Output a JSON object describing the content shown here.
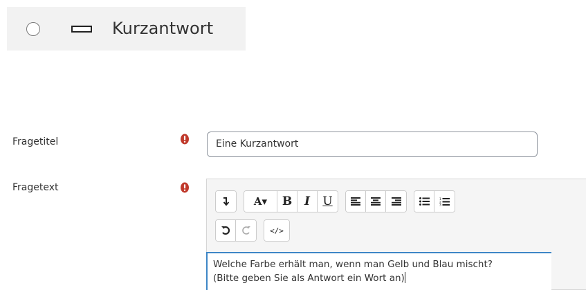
{
  "question_type": {
    "title": "Kurzantwort",
    "radio_icon": "radio-unchecked-icon",
    "type_icon": "short-answer-rect-icon"
  },
  "form": {
    "title_label": "Fragetitel",
    "title_value": "Eine Kurzantwort",
    "text_label": "Fragetext",
    "required_icon": "exclamation-circle-icon",
    "required_color": "#c0392b"
  },
  "editor": {
    "toolbar": {
      "row1": [
        {
          "name": "collapse-toolbar-button",
          "icon": "arrow-down-icon"
        },
        {
          "name": "font-style-button",
          "label": "A▾"
        },
        {
          "name": "bold-button",
          "label": "B"
        },
        {
          "name": "italic-button",
          "label": "I"
        },
        {
          "name": "underline-button",
          "label": "U"
        },
        {
          "name": "align-left-button",
          "icon": "align-left-icon"
        },
        {
          "name": "align-center-button",
          "icon": "align-center-icon"
        },
        {
          "name": "align-right-button",
          "icon": "align-right-icon"
        },
        {
          "name": "unordered-list-button",
          "icon": "list-ul-icon"
        },
        {
          "name": "ordered-list-button",
          "icon": "list-ol-icon"
        }
      ],
      "row2": [
        {
          "name": "undo-button",
          "icon": "undo-icon"
        },
        {
          "name": "redo-button",
          "icon": "redo-icon"
        },
        {
          "name": "html-source-button",
          "label": "</>"
        }
      ]
    },
    "content_lines": [
      "Welche Farbe erhält man, wenn man Gelb und Blau mischt?",
      "(Bitte geben Sie als Antwort ein Wort an)"
    ],
    "focus_color": "#3d86c6"
  }
}
